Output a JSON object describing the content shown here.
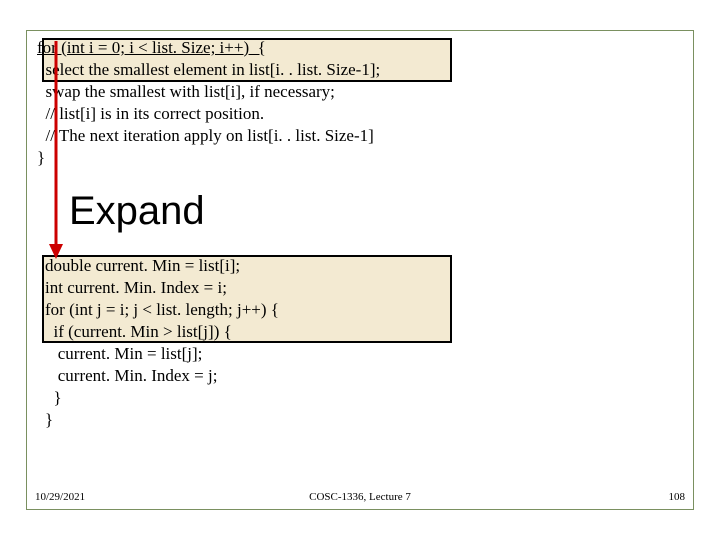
{
  "top_code": {
    "l1": "for (int i = 0; i < list. Size; i++)  {",
    "l2": "  select the smallest element in list[i. . list. Size-1];",
    "l3": "  swap the smallest with list[i], if necessary;",
    "l4": "  // list[i] is in its correct position.",
    "l5": "  // The next iteration apply on list[i. . list. Size-1]",
    "l6": "}"
  },
  "heading": "Expand",
  "bottom_code": {
    "l1": "double current. Min = list[i];",
    "l2": "int current. Min. Index = i;",
    "l3": "for (int j = i; j < list. length; j++) {",
    "l4": "  if (current. Min > list[j]) {",
    "l5": "   current. Min = list[j];",
    "l6": "   current. Min. Index = j;",
    "l7": "  }",
    "l8": "}"
  },
  "footer": {
    "date": "10/29/2021",
    "center": "COSC-1336, Lecture 7",
    "page": "108"
  },
  "colors": {
    "border": "#7a9060",
    "highlight": "#ebdcb4",
    "arrow": "#cc0000"
  }
}
